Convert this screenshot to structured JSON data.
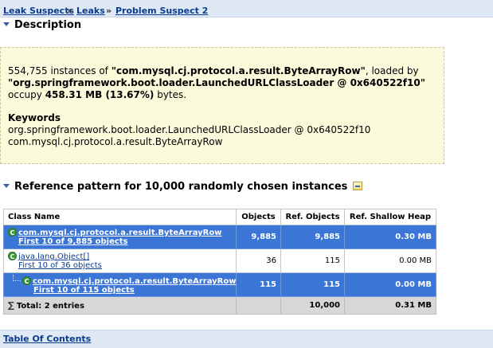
{
  "breadcrumb": {
    "items": [
      "Leak Suspects",
      "Leaks",
      "Problem Suspect 2"
    ],
    "separator": "»"
  },
  "description": {
    "heading": "Description",
    "line1": {
      "count": "554,755",
      "t1": " instances of ",
      "class_name": "\"com.mysql.cj.protocol.a.result.ByteArrayRow\"",
      "t2": ", loaded by"
    },
    "line2": "\"org.springframework.boot.loader.LaunchedURLClassLoader @ 0x640522f10\"",
    "line3": {
      "t1": "occupy ",
      "size": "458.31 MB (13.67%)",
      "t2": " bytes."
    },
    "keywords_heading": "Keywords",
    "keywords": [
      "org.springframework.boot.loader.LaunchedURLClassLoader @ 0x640522f10",
      "com.mysql.cj.protocol.a.result.ByteArrayRow"
    ]
  },
  "reference": {
    "heading": "Reference pattern for 10,000 randomly chosen instances",
    "columns": [
      "Class Name",
      "Objects",
      "Ref. Objects",
      "Ref. Shallow Heap"
    ],
    "rows": [
      {
        "name": "com.mysql.cj.protocol.a.result.ByteArrayRow",
        "sub": "First 10 of 9,885 objects",
        "objects": "9,885",
        "ref_objects": "9,885",
        "ref_shallow": "0.30 MB"
      },
      {
        "name": "java.lang.Object[]",
        "sub": "First 10 of 36 objects",
        "objects": "36",
        "ref_objects": "115",
        "ref_shallow": "0.00 MB"
      },
      {
        "name": "com.mysql.cj.protocol.a.result.ByteArrayRow",
        "sub": "First 10 of 115 objects",
        "objects": "115",
        "ref_objects": "115",
        "ref_shallow": "0.00 MB"
      }
    ],
    "total": {
      "label": "Total: 2 entries",
      "objects": "",
      "ref_objects": "10,000",
      "ref_shallow": "0.31 MB"
    }
  },
  "footer": {
    "toc": "Table Of Contents"
  },
  "colors": {
    "selection": "#3b75d6",
    "description_bg": "#fbfbdc",
    "bar_bg": "#dfe9f6"
  }
}
